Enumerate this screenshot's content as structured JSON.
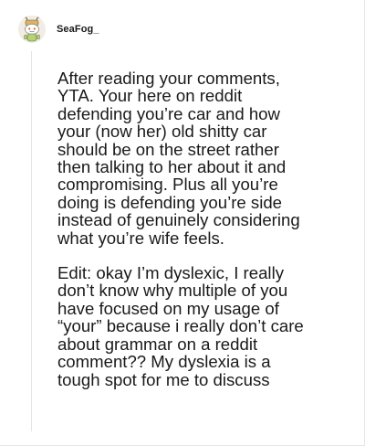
{
  "comment": {
    "username": "SeaFog_",
    "avatar_icon": "snoo-avatar-icon",
    "paragraphs": [
      "After reading your comments,\nYTA. Your here on reddit\ndefending you’re car and how\nyour (now her) old shitty car\nshould be on the street rather\nthen talking to her about it and\ncompromising. Plus all you’re\ndoing is defending you’re side\ninstead of genuinely considering\nwhat you’re wife feels.",
      "Edit: okay I’m dyslexic, I really\ndon’t know why multiple of you\nhave focused on my usage of\n“your” because i really don’t care\nabout grammar on a reddit\ncomment?? My dyslexia is a\ntough spot for me to discuss"
    ]
  },
  "colors": {
    "text": "#1a1a1a",
    "thread_line": "#e4e4e4",
    "background": "#ffffff"
  }
}
